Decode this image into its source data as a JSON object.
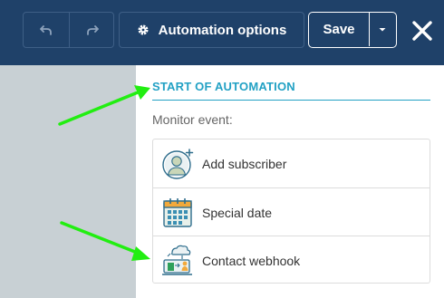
{
  "toolbar": {
    "automation_options_label": "Automation options",
    "save_label": "Save"
  },
  "panel": {
    "section_title": "START OF AUTOMATION",
    "monitor_label": "Monitor event:",
    "items": [
      {
        "label": "Add subscriber",
        "icon": "add-subscriber-icon"
      },
      {
        "label": "Special date",
        "icon": "calendar-icon"
      },
      {
        "label": "Contact webhook",
        "icon": "webhook-icon"
      }
    ]
  },
  "colors": {
    "header_bg": "#1f4169",
    "accent": "#22a1c4",
    "canvas_bg": "#c8d0d4",
    "annotation_arrow": "#22ee11"
  }
}
